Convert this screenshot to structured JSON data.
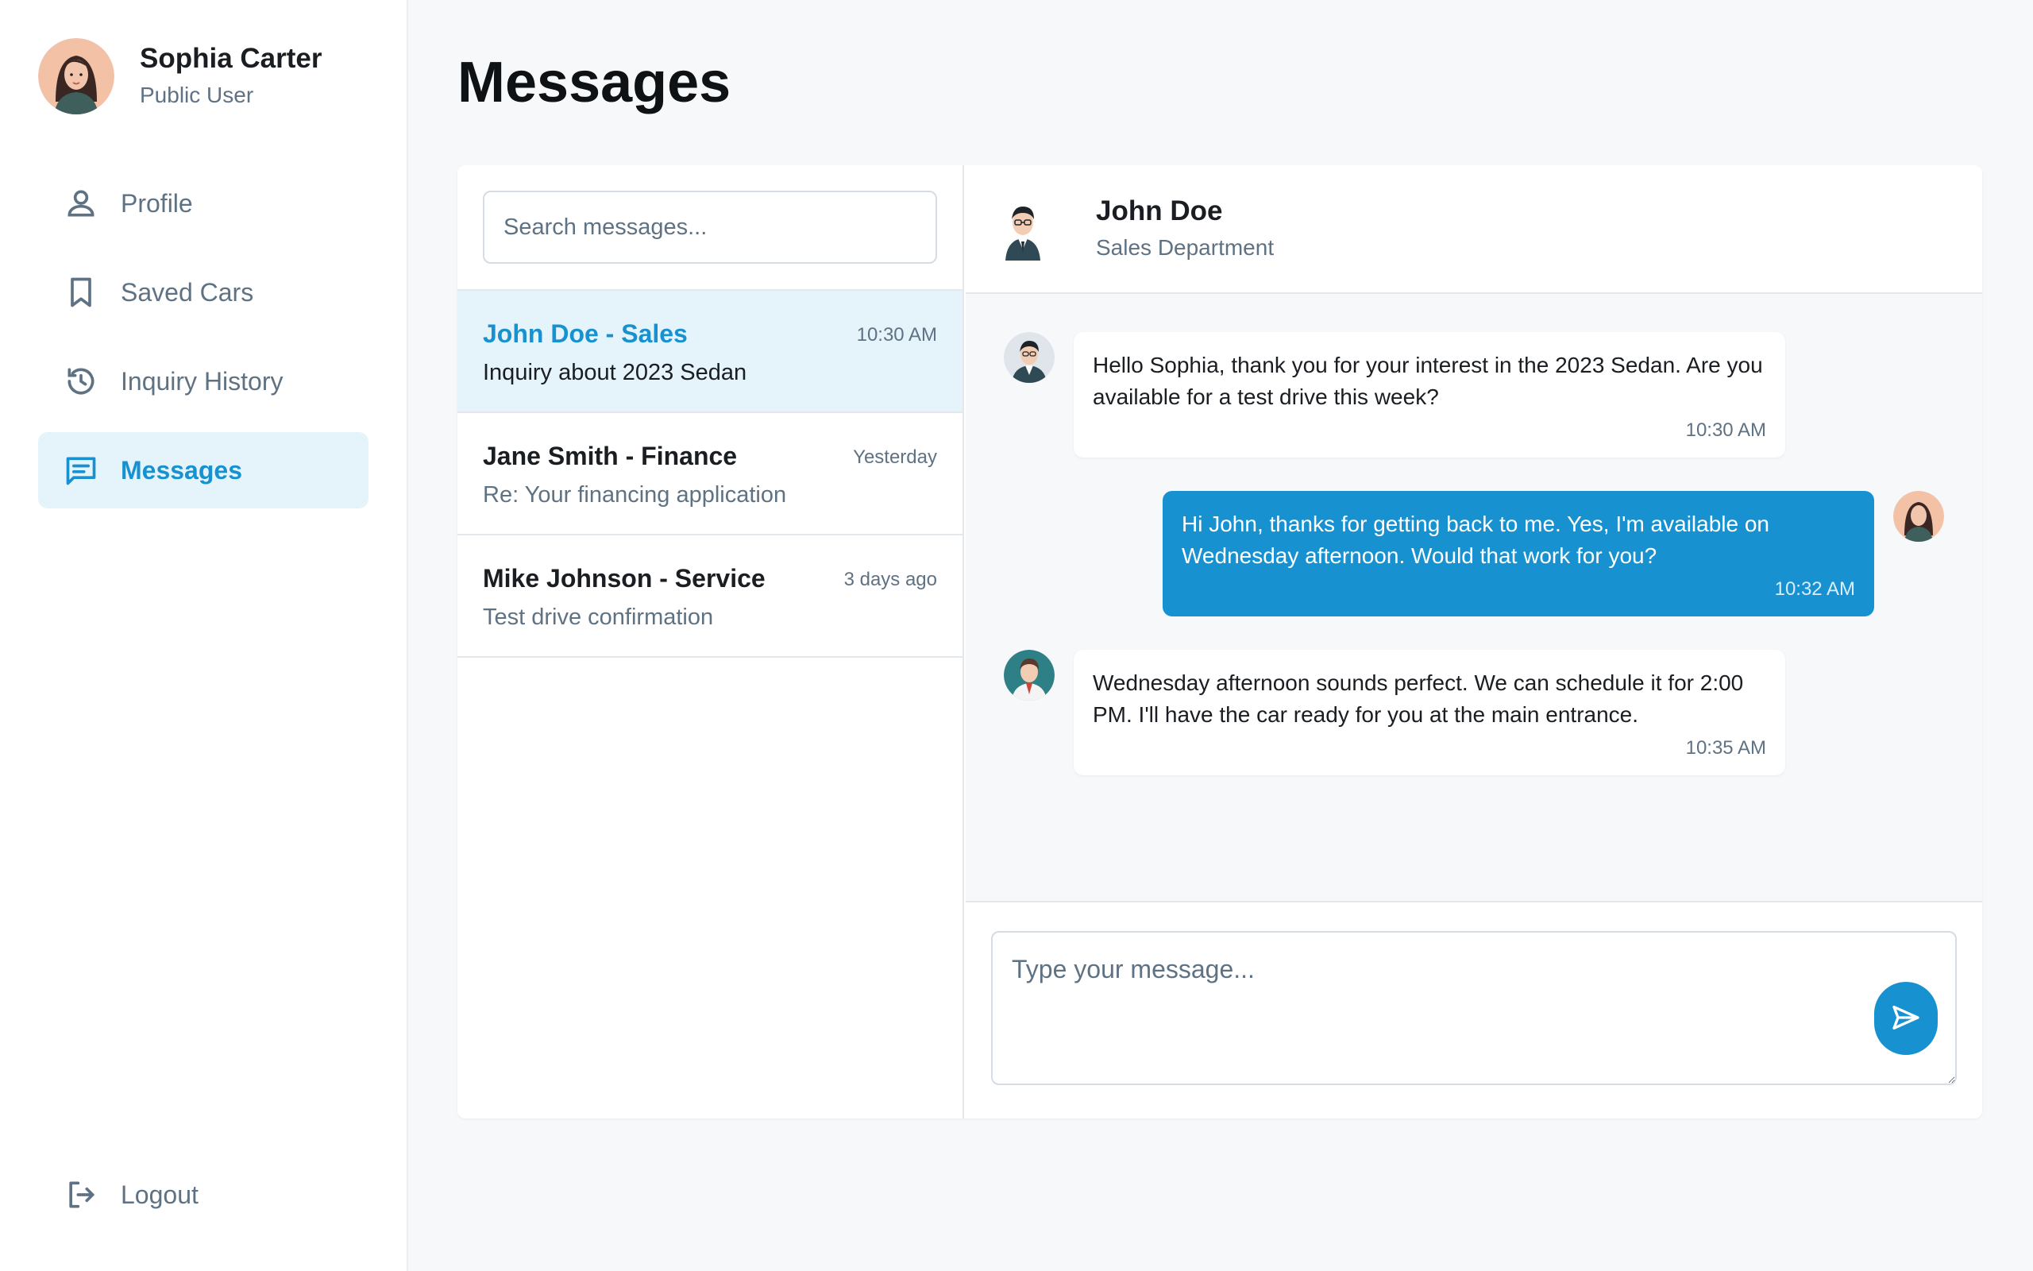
{
  "user": {
    "name": "Sophia Carter",
    "role": "Public User"
  },
  "nav": {
    "items": [
      {
        "label": "Profile",
        "icon": "person-icon",
        "active": false
      },
      {
        "label": "Saved Cars",
        "icon": "bookmark-icon",
        "active": false
      },
      {
        "label": "Inquiry History",
        "icon": "history-icon",
        "active": false
      },
      {
        "label": "Messages",
        "icon": "chat-icon",
        "active": true
      }
    ],
    "logout_label": "Logout"
  },
  "page": {
    "title": "Messages"
  },
  "search": {
    "placeholder": "Search messages..."
  },
  "conversations": [
    {
      "name": "John Doe - Sales",
      "time": "10:30 AM",
      "preview": "Inquiry about 2023 Sedan",
      "active": true
    },
    {
      "name": "Jane Smith - Finance",
      "time": "Yesterday",
      "preview": "Re: Your financing application",
      "active": false
    },
    {
      "name": "Mike Johnson - Service",
      "time": "3 days ago",
      "preview": "Test drive confirmation",
      "active": false
    }
  ],
  "chat": {
    "contact_name": "John Doe",
    "contact_dept": "Sales Department",
    "messages": [
      {
        "from": "agent",
        "text": "Hello Sophia, thank you for your interest in the 2023 Sedan. Are you available for a test drive this week?",
        "time": "10:30 AM"
      },
      {
        "from": "user",
        "text": "Hi John, thanks for getting back to me. Yes, I'm available on Wednesday afternoon. Would that work for you?",
        "time": "10:32 AM"
      },
      {
        "from": "agent",
        "text": "Wednesday afternoon sounds perfect. We can schedule it for 2:00 PM. I'll have the car ready for you at the main entrance.",
        "time": "10:35 AM"
      }
    ],
    "input_placeholder": "Type your message...",
    "send_icon": "send-icon"
  },
  "colors": {
    "accent": "#1791d0",
    "accent_light": "#e5f3fb",
    "muted": "#5f7283",
    "background": "#f6f8fa"
  }
}
